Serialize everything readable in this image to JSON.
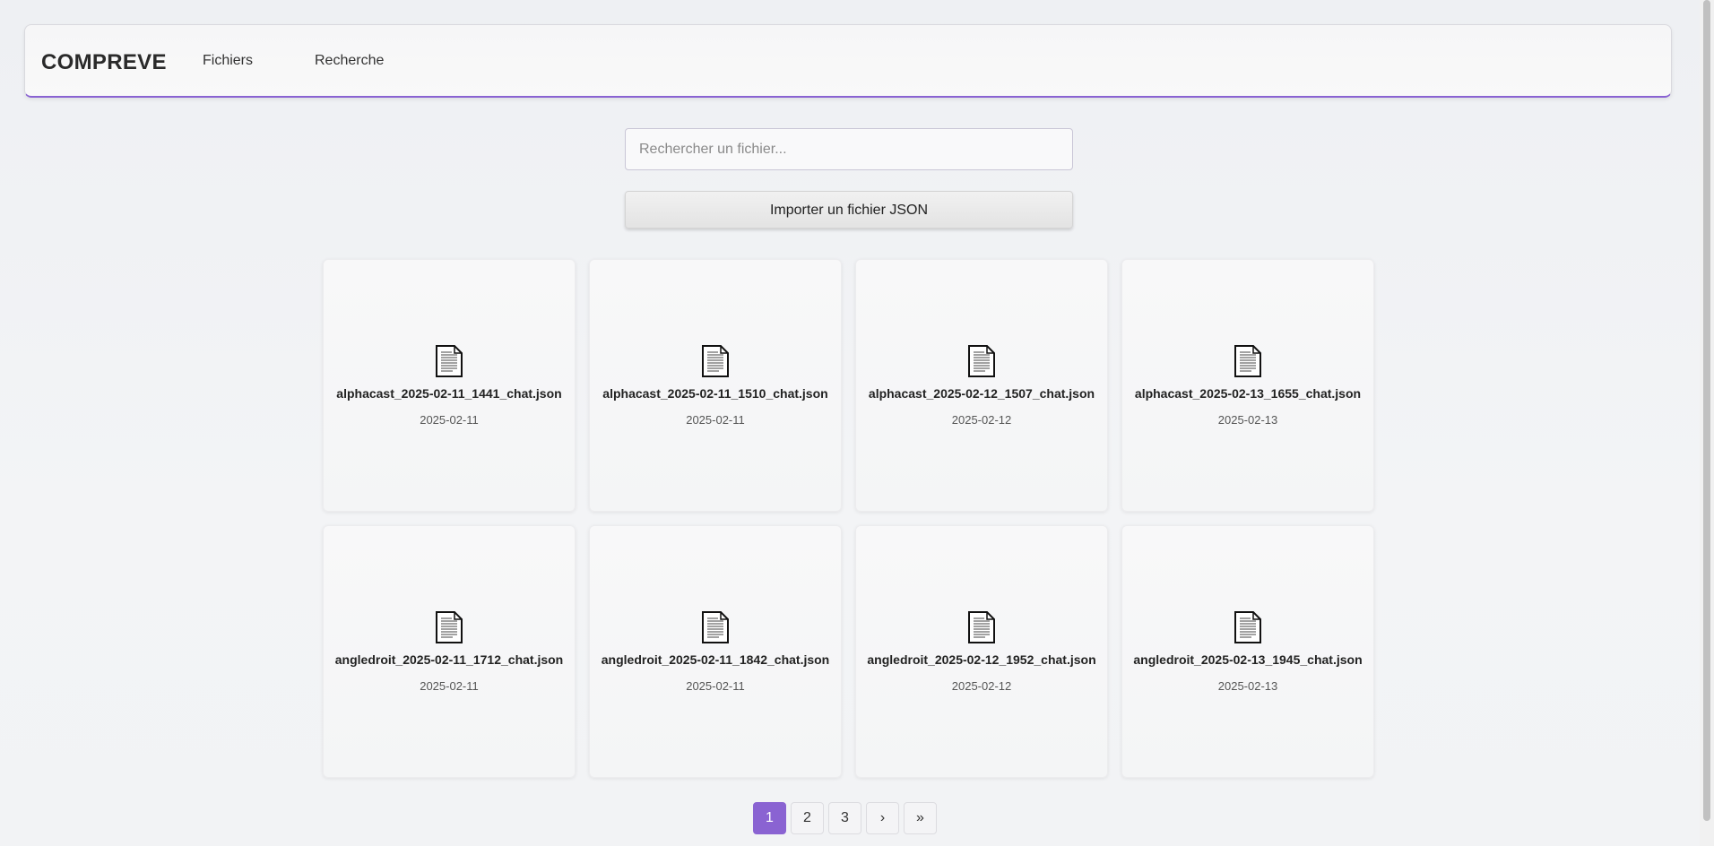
{
  "navbar": {
    "brand": "COMPREVE",
    "links": [
      "Fichiers",
      "Recherche"
    ],
    "accent_color": "#8a63d2"
  },
  "search": {
    "placeholder": "Rechercher un fichier...",
    "value": ""
  },
  "import_button": {
    "label": "Importer un fichier JSON"
  },
  "files": [
    {
      "name": "alphacast_2025-02-11_1441_chat.json",
      "date": "2025-02-11",
      "icon": "document-icon"
    },
    {
      "name": "alphacast_2025-02-11_1510_chat.json",
      "date": "2025-02-11",
      "icon": "document-icon"
    },
    {
      "name": "alphacast_2025-02-12_1507_chat.json",
      "date": "2025-02-12",
      "icon": "document-icon"
    },
    {
      "name": "alphacast_2025-02-13_1655_chat.json",
      "date": "2025-02-13",
      "icon": "document-icon"
    },
    {
      "name": "angledroit_2025-02-11_1712_chat.json",
      "date": "2025-02-11",
      "icon": "document-icon"
    },
    {
      "name": "angledroit_2025-02-11_1842_chat.json",
      "date": "2025-02-11",
      "icon": "document-icon"
    },
    {
      "name": "angledroit_2025-02-12_1952_chat.json",
      "date": "2025-02-12",
      "icon": "document-icon"
    },
    {
      "name": "angledroit_2025-02-13_1945_chat.json",
      "date": "2025-02-13",
      "icon": "document-icon"
    }
  ],
  "pagination": {
    "pages": [
      "1",
      "2",
      "3"
    ],
    "current": "1",
    "next_label": "›",
    "last_label": "»"
  }
}
